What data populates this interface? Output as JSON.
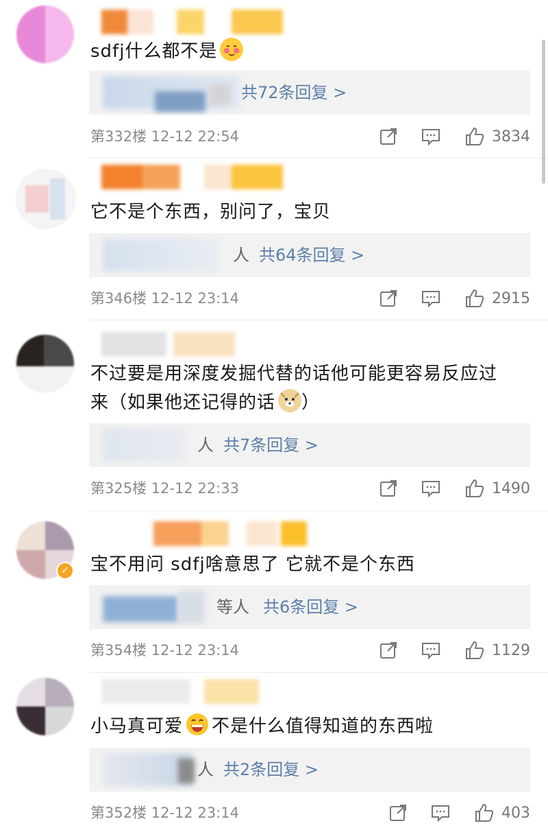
{
  "comments": [
    {
      "text": "sdfj什么都不是",
      "reply_suffix": "",
      "reply_link": "共72条回复 >",
      "floor_time": "第332楼 12-12 22:54",
      "likes": "3834",
      "emoji": "blush-face-icon"
    },
    {
      "text": "它不是个东西，别问了，宝贝",
      "reply_suffix": "人",
      "reply_link": "共64条回复 >",
      "floor_time": "第346楼 12-12 23:14",
      "likes": "2915"
    },
    {
      "text_line1": "不过要是用深度发掘代替的话他可能更容易反应过",
      "text_line2": "来（如果他还记得的话",
      "text_line2_end": "）",
      "reply_suffix": "人",
      "reply_link": "共7条回复 >",
      "floor_time": "第325楼 12-12 22:33",
      "likes": "1490",
      "emoji": "doge-icon"
    },
    {
      "text": "宝不用问 sdfj啥意思了 它就不是个东西",
      "reply_suffix": "等人",
      "reply_link": "共6条回复 >",
      "floor_time": "第354楼 12-12 23:14",
      "likes": "1129",
      "badge": "✓"
    },
    {
      "text_a": "小马真可爱",
      "text_b": "不是什么值得知道的东西啦",
      "reply_suffix": "人",
      "reply_link": "共2条回复 >",
      "floor_time": "第352楼 12-12 23:14",
      "likes": "403",
      "emoji": "grin-face-icon"
    }
  ],
  "colors": {
    "link": "#5a7fa8",
    "meta": "#8a8a8a",
    "reply_bg": "#f2f2f2"
  }
}
